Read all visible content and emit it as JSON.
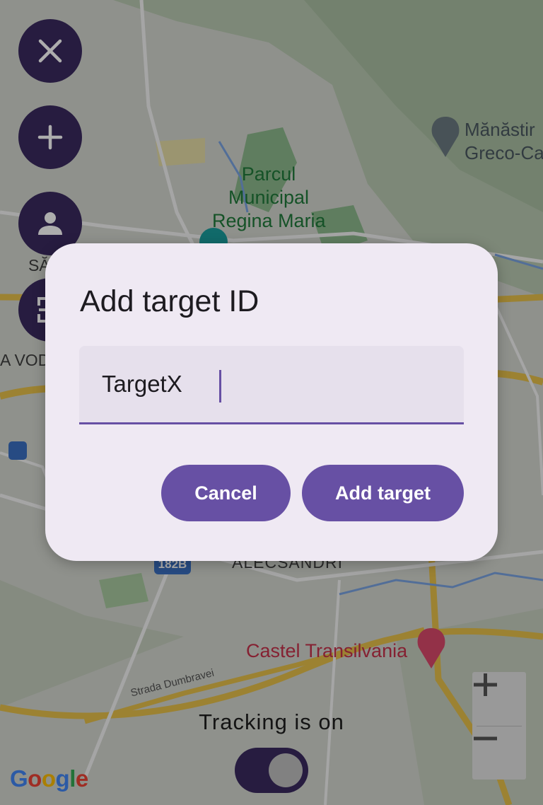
{
  "map": {
    "labels": {
      "park_line1": "Parcul",
      "park_line2": "Municipal",
      "park_line3": "Regina Maria",
      "monastery_line1": "Mănăstir",
      "monastery_line2": "Greco-Ca",
      "district_sa": "SĂ",
      "district_vod": "A VOD",
      "district_alecsandri": "ALECSANDRI",
      "road_badge": "182B",
      "castle": "Castel Transilvania",
      "street": "Strada Dumbravei"
    },
    "zoom": {
      "in_label": "+",
      "out_label": "−"
    },
    "attribution": [
      "G",
      "o",
      "o",
      "g",
      "l",
      "e"
    ]
  },
  "side_buttons": [
    {
      "icon": "close-icon"
    },
    {
      "icon": "plus-icon"
    },
    {
      "icon": "person-icon"
    },
    {
      "icon": "scan-icon"
    }
  ],
  "tracking": {
    "label": "Tracking is on",
    "enabled": true
  },
  "dialog": {
    "title": "Add target ID",
    "input_value": "TargetX",
    "cancel_label": "Cancel",
    "confirm_label": "Add target"
  },
  "colors": {
    "primary": "#6750a4",
    "fab_dark": "#3a2a5f",
    "dialog_bg": "#efe9f3",
    "park_text": "#1f7a3a",
    "castle_text": "#c5314a"
  }
}
